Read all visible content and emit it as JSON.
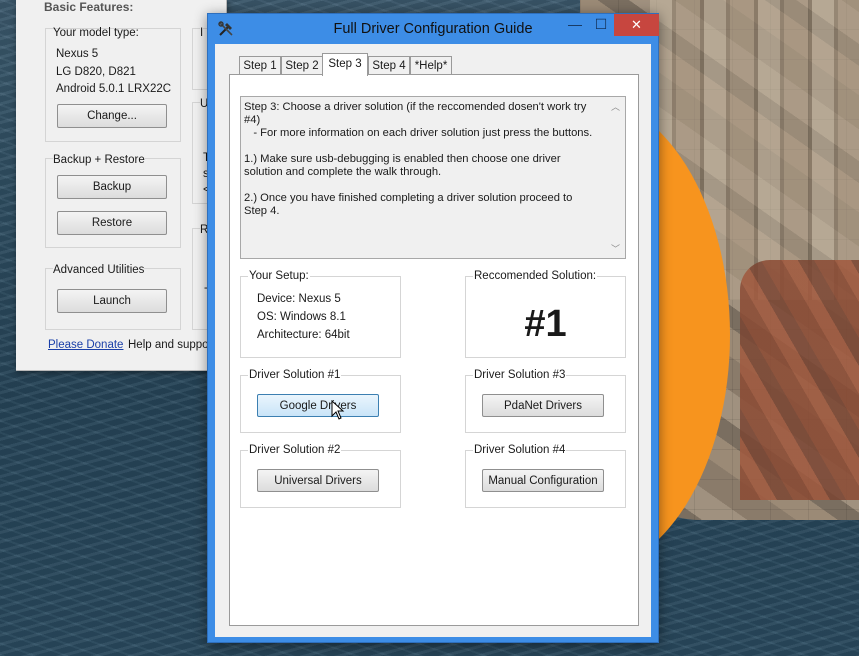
{
  "background_window": {
    "section_title": "Basic Features:",
    "model_group": {
      "label": "Your model type:",
      "lines": [
        "Nexus 5",
        "LG D820, D821",
        "Android 5.0.1 LRX22C"
      ],
      "change_button": "Change..."
    },
    "backup_group": {
      "label": "Backup + Restore",
      "backup_button": "Backup",
      "restore_button": "Restore"
    },
    "advanced_group": {
      "label": "Advanced Utilities",
      "launch_button": "Launch"
    },
    "donate_link": "Please Donate",
    "help_text": "Help and support",
    "partial_glyphs": [
      "I",
      "U",
      "T",
      "s",
      "<",
      "R",
      "-"
    ]
  },
  "dialog": {
    "title": "Full Driver Configuration Guide",
    "caption_buttons": {
      "minimize": "—",
      "maximize": "☐",
      "close": "✕"
    },
    "tabs": [
      {
        "label": "Step 1",
        "active": false
      },
      {
        "label": "Step 2",
        "active": false
      },
      {
        "label": "Step 3",
        "active": true
      },
      {
        "label": "Step 4",
        "active": false
      },
      {
        "label": "*Help*",
        "active": false
      }
    ],
    "instructions": {
      "line1": "Step 3:  Choose a driver solution (if the reccomended dosen't work try #4)",
      "line2": "   - For more information on each driver solution just press the buttons.",
      "line3": "1.)  Make sure usb-debugging is enabled then choose one driver solution and complete the walk through.",
      "line4": "2.)  Once you have finished completing a driver solution proceed to Step 4."
    },
    "setup": {
      "label": "Your Setup:",
      "device": "Device: Nexus 5",
      "os": "OS: Windows 8.1",
      "architecture": "Architecture: 64bit"
    },
    "recommended": {
      "label": "Reccomended Solution:",
      "value": "#1"
    },
    "solutions": [
      {
        "label": "Driver Solution #1",
        "button": "Google Drivers"
      },
      {
        "label": "Driver Solution #3",
        "button": "PdaNet Drivers"
      },
      {
        "label": "Driver Solution #2",
        "button": "Universal Drivers"
      },
      {
        "label": "Driver Solution #4",
        "button": "Manual Configuration"
      }
    ]
  },
  "colors": {
    "title_bar": "#3d8de6",
    "close_button": "#c7463f",
    "wallpaper_orange": "#f7941e",
    "hover_button": "#c9e4f8"
  }
}
